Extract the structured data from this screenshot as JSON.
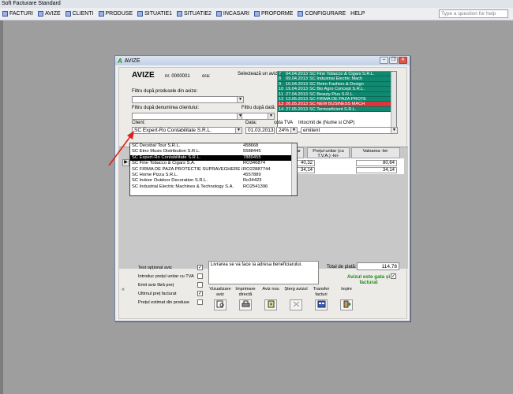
{
  "app": {
    "title": "Soft Facturare Standard",
    "search_placeholder": "Type a question for help"
  },
  "menu": [
    {
      "label": "FACTURI",
      "icon": "invoice-icon"
    },
    {
      "label": "AVIZE",
      "icon": "document-icon"
    },
    {
      "label": "CLIENTI",
      "icon": "clients-icon"
    },
    {
      "label": "PRODUSE",
      "icon": "products-icon"
    },
    {
      "label": "SITUATIE1",
      "icon": "report-icon"
    },
    {
      "label": "SITUATIE2",
      "icon": "report-icon"
    },
    {
      "label": "INCASARI",
      "icon": "payments-icon"
    },
    {
      "label": "PROFORME",
      "icon": "proforma-icon"
    },
    {
      "label": "CONFIGURARE",
      "icon": "settings-icon"
    },
    {
      "label": "HELP",
      "icon": ""
    }
  ],
  "window": {
    "title": "AVIZE",
    "heading": "AVIZE",
    "nr_label": "nr. 0000001",
    "ora_label": "ora:",
    "select_label": "Selectează un aviz:"
  },
  "filters": {
    "products_label": "Filtru după produsele din avize:",
    "client_name_label": "Filtru după denumirea clientului:",
    "date_label": "Filtru după dată:",
    "client_label": "Client:",
    "client_value": "SC Expert-Ro Contabilitate S.R.L.",
    "data_label": "Data:",
    "data_value": "01.03.2013",
    "cota_label": "cota TVA",
    "cota_value": "24%",
    "intocmit_label": "Intocmit de (Nume si CNP)",
    "intocmit_value": "emitent"
  },
  "aviz_list": [
    {
      "nr": "7",
      "date": "04.04.2013",
      "client": "SC Fine Tobacco & Cigars S.R.L.",
      "selected": false
    },
    {
      "nr": "8",
      "date": "09.04.2013",
      "client": "SC Industrial Electric Mach",
      "selected": false
    },
    {
      "nr": "9",
      "date": "10.04.2013",
      "client": "SC Retro Fashion & Design",
      "selected": false
    },
    {
      "nr": "10",
      "date": "19.04.2013",
      "client": "SC Bio Agro Concept S.R.L.",
      "selected": false
    },
    {
      "nr": "11",
      "date": "27.04.2013",
      "client": "SC Beauty Plus S.R.L.",
      "selected": false
    },
    {
      "nr": "12",
      "date": "13.05.2013",
      "client": "SC FIRMA DE PAZA PROTE",
      "selected": false
    },
    {
      "nr": "13",
      "date": "26.05.2013",
      "client": "SC NEW BUSINESS MACH",
      "selected": true
    },
    {
      "nr": "14",
      "date": "27.05.2013",
      "client": "SC Termoeficient S.R.L.",
      "selected": false
    }
  ],
  "client_options": [
    {
      "name": "SC Decebal Tour S.R.L.",
      "code": "458668",
      "selected": false
    },
    {
      "name": "SC Etno Music Distribution S.R.L.",
      "code": "5588445",
      "selected": false
    },
    {
      "name": "SC Expert-Ro Contabilitate S.R.L.",
      "code": "7889455",
      "selected": true
    },
    {
      "name": "SC Fine Tobacco & Cigars S.A.",
      "code": "RO346874",
      "selected": false
    },
    {
      "name": "SC FIRMA DE PAZA PROTECTIE SUPRAVEGHERE IN",
      "code": "RO22887744",
      "selected": false
    },
    {
      "name": "SC Home Pizza S.R.L.",
      "code": "4557889",
      "selected": false
    },
    {
      "name": "SC Indoor Outdoor Decoration S.R.L.",
      "code": "Ro34423",
      "selected": false
    },
    {
      "name": "SC Industrial Electric Machines & Technology S.A.",
      "code": "RO2541396",
      "selected": false
    }
  ],
  "grid": {
    "col_pret": "unitar",
    "col_pret_tva": "Prețul unitar (cu T.V.A.) -lei-",
    "col_valoare": "Valoarea -lei-",
    "rows": [
      {
        "pret": "40,32",
        "valoare": "80,64"
      },
      {
        "pret": "34,14",
        "valoare": "34,14"
      }
    ]
  },
  "options": [
    {
      "label": "Text opțional aviz",
      "checked": true
    },
    {
      "label": "Introduc prețul unitar cu TVA",
      "checked": false
    },
    {
      "label": "Emit aviz fără preț",
      "checked": false
    },
    {
      "label": "Ultimul preț facturat",
      "checked": true
    },
    {
      "label": "Prețul estimat din produse",
      "checked": false
    }
  ],
  "notes_text": "Livrarea se va face la adresa beneficiarului.",
  "buttons": [
    {
      "label": "Vizualizare aviz",
      "icon": "preview-icon"
    },
    {
      "label": "Imprimare directă",
      "icon": "printer-icon"
    },
    {
      "label": "Aviz nou",
      "icon": "new-document-icon"
    },
    {
      "label": "Șterg avizul",
      "icon": "delete-icon"
    },
    {
      "label": "Transfer facturi",
      "icon": "transfer-icon"
    },
    {
      "label": "Ieșire",
      "icon": "exit-icon"
    }
  ],
  "totals": {
    "label": "Total de plată:",
    "value": "114,78",
    "status": "Avizul este gata și facturat"
  },
  "colors": {
    "list_bg": "#0f8a70",
    "list_selected": "#d9363e",
    "status_green": "#1d8a1d",
    "arrow_red": "#e0201a"
  }
}
